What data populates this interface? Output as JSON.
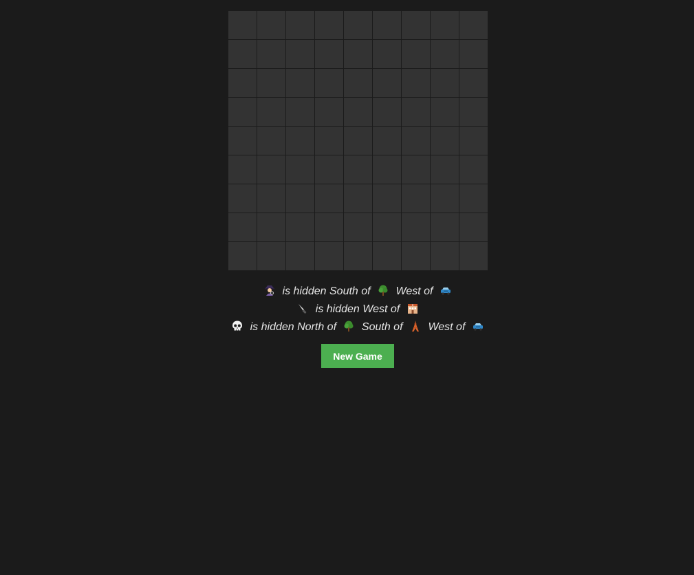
{
  "board": {
    "rows": 9,
    "cols": 9
  },
  "clues": [
    {
      "subject_icon": "detective-icon",
      "parts": [
        {
          "text": "is hidden South of",
          "icon": "tree-icon"
        },
        {
          "text": "West of",
          "icon": "car-icon"
        }
      ]
    },
    {
      "subject_icon": "knife-icon",
      "parts": [
        {
          "text": "is hidden West of",
          "icon": "building-icon"
        }
      ]
    },
    {
      "subject_icon": "skull-icon",
      "parts": [
        {
          "text": "is hidden North of",
          "icon": "tree-icon"
        },
        {
          "text": "South of",
          "icon": "tower-icon"
        },
        {
          "text": "West of",
          "icon": "car-icon"
        }
      ]
    }
  ],
  "clue_texts": {
    "c0_p0": "is hidden South of",
    "c0_p1": "West of",
    "c1_p0": "is hidden West of",
    "c2_p0": "is hidden North of",
    "c2_p1": "South of",
    "c2_p2": "West of"
  },
  "new_game_label": "New Game",
  "colors": {
    "background": "#1b1b1b",
    "cell": "#333333",
    "button": "#4caf50",
    "text": "#e6e6e6"
  }
}
